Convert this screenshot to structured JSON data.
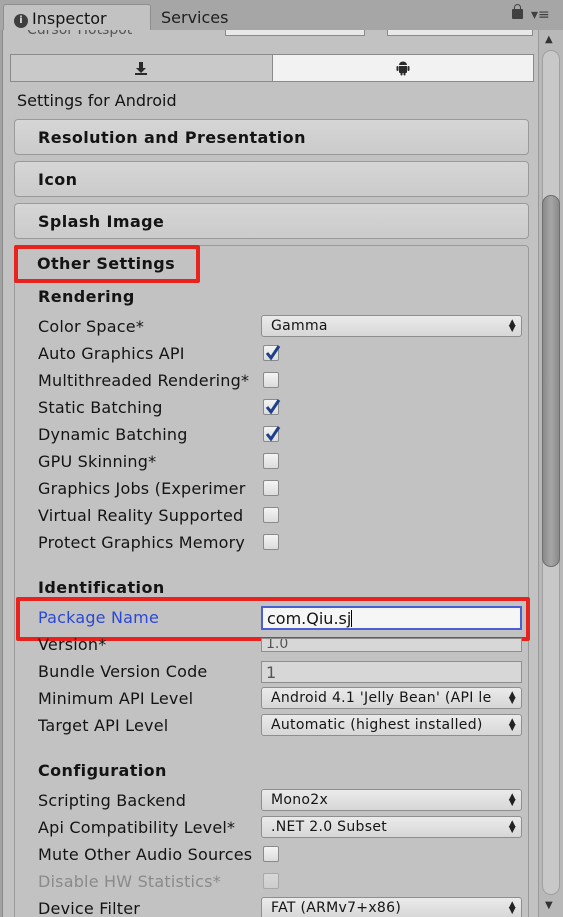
{
  "tabs": {
    "inspector": "Inspector",
    "services": "Services"
  },
  "header": {
    "cutoff_label": "Cursor Hotspot"
  },
  "platform_tabs": [
    "standalone-download-icon",
    "android-icon"
  ],
  "settings_for": "Settings for Android",
  "foldouts": {
    "resolution": "Resolution and Presentation",
    "icon": "Icon",
    "splash": "Splash Image",
    "other": "Other Settings"
  },
  "rendering": {
    "title": "Rendering",
    "color_space_label": "Color Space*",
    "color_space_value": "Gamma",
    "auto_graphics_label": "Auto Graphics API",
    "auto_graphics_checked": true,
    "multithreaded_label": "Multithreaded Rendering*",
    "multithreaded_checked": false,
    "static_batching_label": "Static Batching",
    "static_batching_checked": true,
    "dynamic_batching_label": "Dynamic Batching",
    "dynamic_batching_checked": true,
    "gpu_skinning_label": "GPU Skinning*",
    "gpu_skinning_checked": false,
    "graphics_jobs_label": "Graphics Jobs (Experimer",
    "graphics_jobs_checked": false,
    "vr_supported_label": "Virtual Reality Supported",
    "vr_supported_checked": false,
    "protect_memory_label": "Protect Graphics Memory",
    "protect_memory_checked": false
  },
  "identification": {
    "title": "Identification",
    "package_name_label": "Package Name",
    "package_name_value": "com.Qiu.sj",
    "version_label": "Version*",
    "version_value": "1.0",
    "bundle_code_label": "Bundle Version Code",
    "bundle_code_value": "1",
    "min_api_label": "Minimum API Level",
    "min_api_value": "Android 4.1 'Jelly Bean' (API le",
    "target_api_label": "Target API Level",
    "target_api_value": "Automatic (highest installed)"
  },
  "configuration": {
    "title": "Configuration",
    "scripting_backend_label": "Scripting Backend",
    "scripting_backend_value": "Mono2x",
    "api_compat_label": "Api Compatibility Level*",
    "api_compat_value": ".NET 2.0 Subset",
    "mute_audio_label": "Mute Other Audio Sources",
    "mute_audio_checked": false,
    "disable_hw_label": "Disable HW Statistics*",
    "disable_hw_checked": false,
    "device_filter_label": "Device Filter",
    "device_filter_value": "FAT (ARMv7+x86)"
  },
  "colors": {
    "highlight": "#e8231d",
    "package_label": "#2a48d8",
    "checkmark": "#1e3f8a"
  }
}
